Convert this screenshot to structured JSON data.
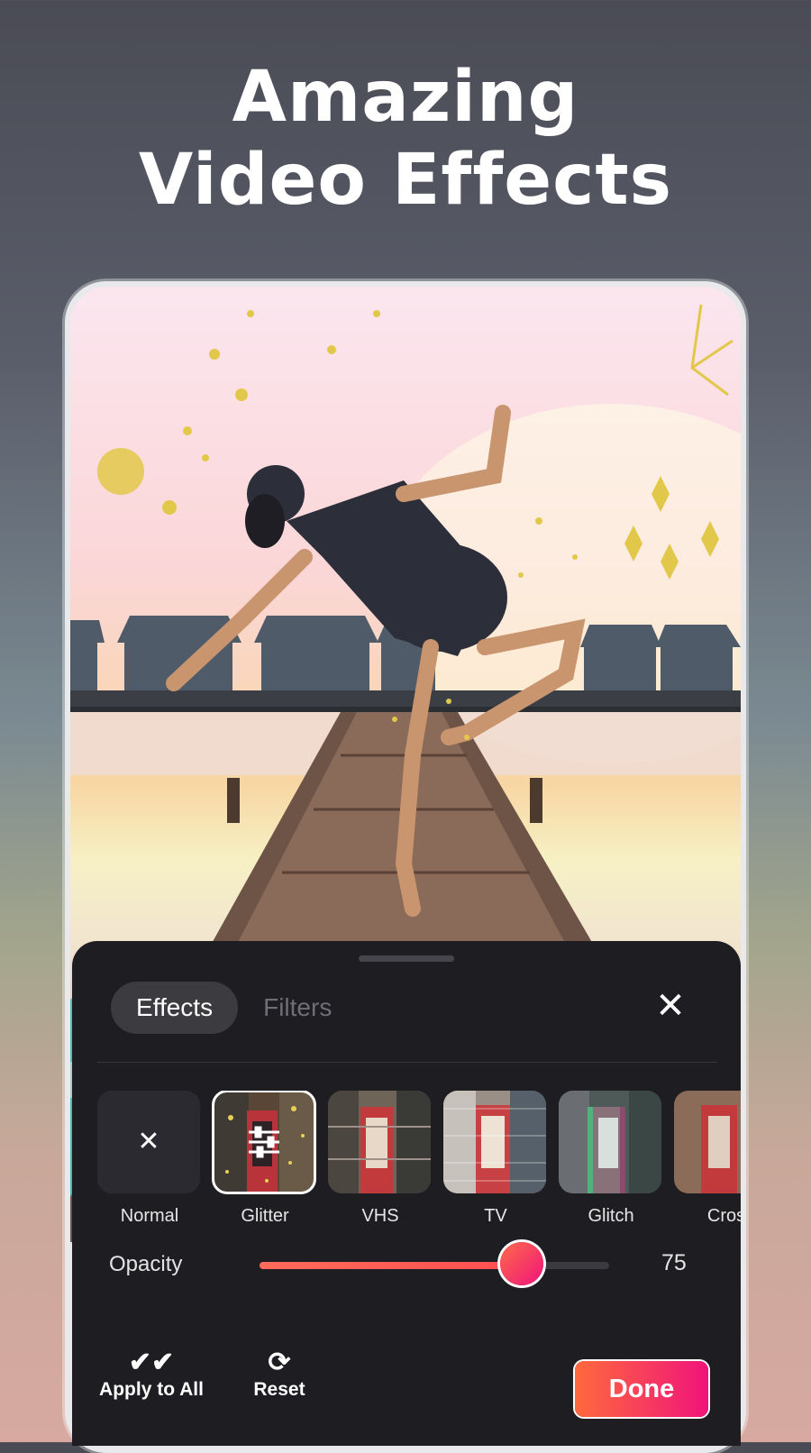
{
  "headline": {
    "line1": "Amazing",
    "line2": "Video Effects"
  },
  "tabs": [
    {
      "label": "Effects",
      "active": true
    },
    {
      "label": "Filters",
      "active": false
    }
  ],
  "close_icon": "close-icon",
  "effects": [
    {
      "label": "Normal",
      "icon": "close-icon",
      "selected": false
    },
    {
      "label": "Glitter",
      "icon": "sliders-icon",
      "selected": true
    },
    {
      "label": "VHS",
      "selected": false
    },
    {
      "label": "TV",
      "selected": false
    },
    {
      "label": "Glitch",
      "selected": false
    },
    {
      "label": "Cros",
      "selected": false
    }
  ],
  "opacity": {
    "label": "Opacity",
    "value": "75",
    "level": 0.75
  },
  "actions": {
    "apply_all": {
      "label": "Apply to All",
      "icon": "double-check-icon"
    },
    "reset": {
      "label": "Reset",
      "icon": "refresh-icon"
    },
    "done": "Done"
  },
  "colors": {
    "accent_start": "#ff6a3d",
    "accent_end": "#f0147a",
    "panel": "#1e1e22"
  }
}
